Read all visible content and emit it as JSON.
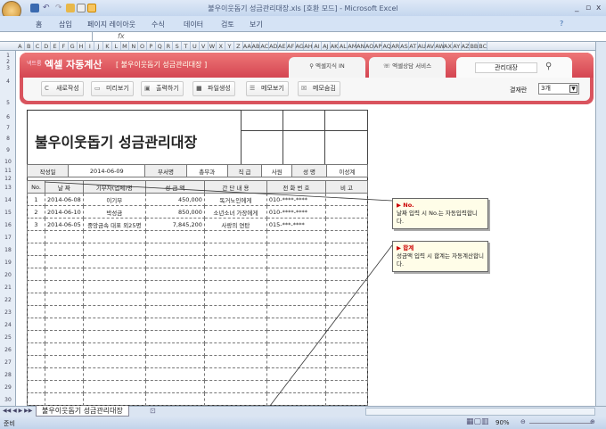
{
  "window": {
    "title": "불우이웃돕기 성금관리대장.xls [호환 모드] - Microsoft Excel",
    "controls": [
      "_",
      "▫",
      "x"
    ]
  },
  "ribbon": {
    "tabs": [
      "홈",
      "삽입",
      "페이지 레이아웃",
      "수식",
      "데이터",
      "검토",
      "보기"
    ]
  },
  "formula_bar": {
    "fx": "fx",
    "name_box": "",
    "value": ""
  },
  "columns": [
    "A",
    "B",
    "C",
    "D",
    "E",
    "F",
    "G",
    "H",
    "I",
    "J",
    "K",
    "L",
    "M",
    "N",
    "O",
    "P",
    "Q",
    "R",
    "S",
    "T",
    "U",
    "V",
    "W",
    "X",
    "Y",
    "Z",
    "AA",
    "AB",
    "AC",
    "AD",
    "AE",
    "AF",
    "AG",
    "AH",
    "AI",
    "AJ",
    "AK",
    "AL",
    "AM",
    "AN",
    "AO",
    "AP",
    "AQ",
    "AR",
    "AS",
    "AT",
    "AU",
    "AV",
    "AW",
    "AX",
    "AY",
    "AZ",
    "BB",
    "BC"
  ],
  "rows": [
    "1",
    "2",
    "3",
    "4",
    "5",
    "6",
    "7",
    "8",
    "9",
    "10",
    "11",
    "12",
    "13",
    "14",
    "15",
    "16",
    "17",
    "18",
    "19",
    "20",
    "21",
    "22",
    "23",
    "24",
    "25",
    "26",
    "27",
    "28",
    "29",
    "30"
  ],
  "banner": {
    "brand_small": "넥트룸",
    "brand": "엑셀 자동계산",
    "subtitle": "[ 불우이웃돕기 성금관리대장 ]",
    "tabs": [
      "엑셀지식 IN",
      "엑셀상담 서비스"
    ],
    "search_value": "관리대장",
    "buttons": [
      {
        "label": "새로작성",
        "icon": "refresh-icon"
      },
      {
        "label": "미리보기",
        "icon": "monitor-icon"
      },
      {
        "label": "출력하기",
        "icon": "print-icon"
      },
      {
        "label": "파일생성",
        "icon": "folder-icon"
      },
      {
        "label": "메모보기",
        "icon": "memo-icon"
      },
      {
        "label": "메모숨김",
        "icon": "close-box-icon"
      }
    ],
    "approval_label": "결재란",
    "approval_value": "3개"
  },
  "form": {
    "title": "불우이웃돕기 성금관리대장",
    "info": {
      "date_label": "작성일",
      "date": "2014-06-09",
      "dept_label": "부서명",
      "dept": "총무과",
      "rank_label": "직 급",
      "rank": "사원",
      "name_label": "성 명",
      "name": "이성계"
    },
    "headers": [
      "No.",
      "날 짜",
      "기부자(업체)명",
      "성 금 액",
      "간 단 내 용",
      "전 화 번 호",
      "비 고"
    ],
    "rows": [
      [
        "1",
        "2014-06-08",
        "이기부",
        "450,000",
        "독거노인에게",
        "010-****-****",
        ""
      ],
      [
        "2",
        "2014-06-10",
        "박성금",
        "850,000",
        "소년소녀 가장에게",
        "010-****-****",
        ""
      ],
      [
        "3",
        "2014-06-05",
        "중앙금속 대표 외25명",
        "7,845,200",
        "사랑의 연탄",
        "015-***-****",
        ""
      ]
    ]
  },
  "comments": [
    {
      "title": "▶ No.",
      "text": "날짜 입력 시 No.는 자동입력합니다."
    },
    {
      "title": "▶ 합계",
      "text": "성금액 입력 시 합계는 자동계산합니다."
    }
  ],
  "sheet_tab": "불우이웃돕기 성금관리대장",
  "status": {
    "ready": "준비",
    "zoom": "90%"
  }
}
